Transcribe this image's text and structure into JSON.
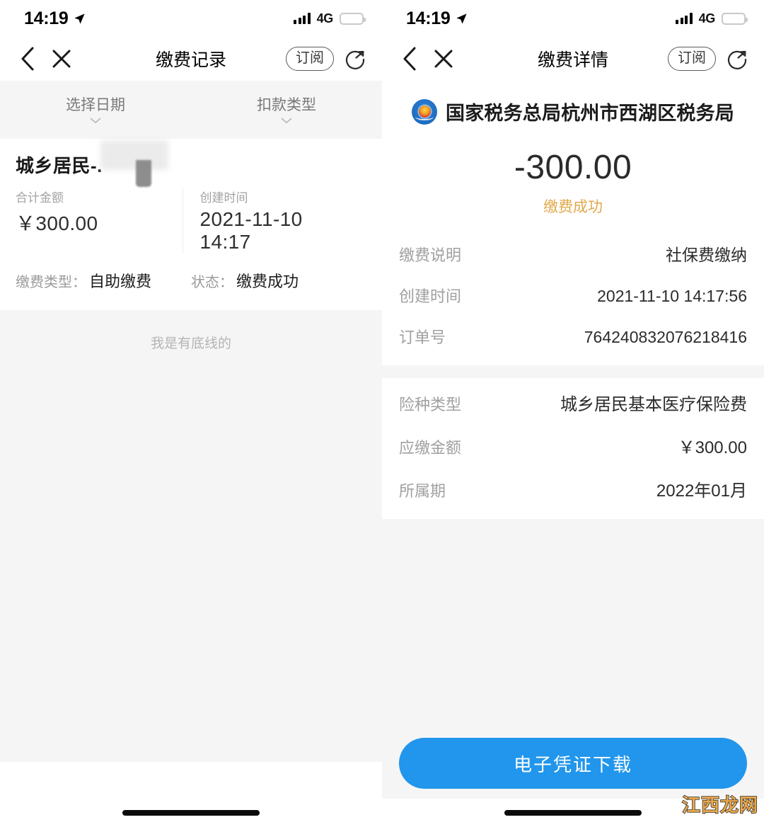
{
  "status_bar": {
    "time": "14:19",
    "network": "4G",
    "location_icon": "location-arrow-icon",
    "signal_icon": "signal-bars-icon",
    "battery_icon": "battery-low-power-icon",
    "battery_color": "#f7ce46"
  },
  "left_screen": {
    "nav": {
      "back_icon": "chevron-left-icon",
      "close_icon": "close-x-icon",
      "title": "缴费记录",
      "subscribe_label": "订阅",
      "share_icon": "share-icon"
    },
    "filters": [
      {
        "label": "选择日期",
        "caret_icon": "chevron-down-icon"
      },
      {
        "label": "扣款类型",
        "caret_icon": "chevron-down-icon"
      }
    ],
    "record": {
      "title": "城乡居民-.",
      "total_label": "合计金额",
      "total_value": "￥300.00",
      "created_label": "创建时间",
      "created_value": "2021-11-10 14:17",
      "pay_type_label": "缴费类型：",
      "pay_type_value": "自助缴费",
      "status_label": "状态：",
      "status_value": "缴费成功"
    },
    "list_end_note": "我是有底线的"
  },
  "right_screen": {
    "nav": {
      "back_icon": "chevron-left-icon",
      "close_icon": "close-x-icon",
      "title": "缴费详情",
      "subscribe_label": "订阅",
      "share_icon": "share-icon"
    },
    "hero": {
      "emblem_icon": "tax-bureau-emblem-icon",
      "org_name": "国家税务总局杭州市西湖区税务局",
      "amount": "-300.00",
      "status": "缴费成功",
      "status_color": "#e0a94b"
    },
    "group_one": [
      {
        "key": "缴费说明",
        "value": "社保费缴纳"
      },
      {
        "key": "创建时间",
        "value": "2021-11-10 14:17:56"
      },
      {
        "key": "订单号",
        "value": "764240832076218416"
      }
    ],
    "group_two": [
      {
        "key": "险种类型",
        "value": "城乡居民基本医疗保险费"
      },
      {
        "key": "应缴金额",
        "value": "￥300.00"
      },
      {
        "key": "所属期",
        "value": "2022年01月"
      }
    ],
    "cta_label": "电子凭证下载",
    "cta_color": "#2196ec"
  },
  "watermark": {
    "text": "江西龙网",
    "color": "#e8a64a"
  }
}
